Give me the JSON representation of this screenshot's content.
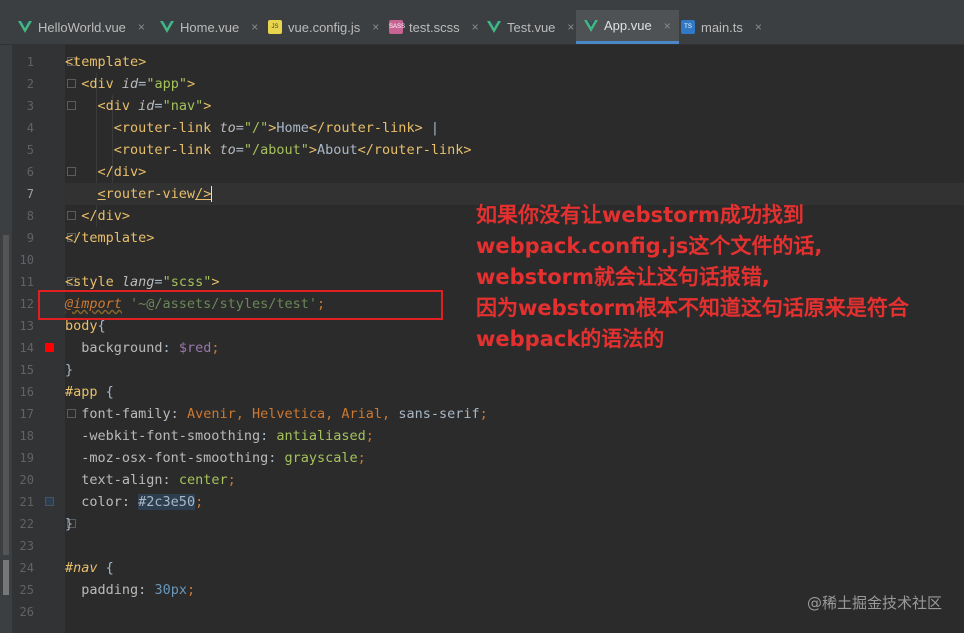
{
  "tabs": [
    {
      "label": "HelloWorld.vue",
      "type": "vue",
      "active": false
    },
    {
      "label": "Home.vue",
      "type": "vue",
      "active": false
    },
    {
      "label": "vue.config.js",
      "type": "js",
      "active": false
    },
    {
      "label": "test.scss",
      "type": "scss",
      "active": false
    },
    {
      "label": "Test.vue",
      "type": "vue",
      "active": false
    },
    {
      "label": "App.vue",
      "type": "vue",
      "active": true
    },
    {
      "label": "main.ts",
      "type": "ts",
      "active": false
    }
  ],
  "close_glyph": "×",
  "badges": {
    "js": "JS",
    "scss": "SASS",
    "ts": "TS"
  },
  "line_numbers": [
    "1",
    "2",
    "3",
    "4",
    "5",
    "6",
    "7",
    "8",
    "9",
    "10",
    "11",
    "12",
    "13",
    "14",
    "15",
    "16",
    "17",
    "18",
    "19",
    "20",
    "21",
    "22",
    "23",
    "24",
    "25",
    "26"
  ],
  "current_line": "7",
  "code": {
    "l1_tag": "<template>",
    "l2_open": "<div ",
    "l2_attr": "id",
    "l2_eq": "=",
    "l2_val": "\"app\"",
    "l2_close": ">",
    "l3_open": "<div ",
    "l3_attr": "id",
    "l3_eq": "=",
    "l3_val": "\"nav\"",
    "l3_close": ">",
    "l4_open": "<router-link ",
    "l4_attr": "to",
    "l4_eq": "=",
    "l4_val": "\"/\"",
    "l4_close": ">",
    "l4_text": "Home",
    "l4_end": "</router-link>",
    "l4_caret": " |",
    "l5_open": "<router-link ",
    "l5_attr": "to",
    "l5_eq": "=",
    "l5_val": "\"/about\"",
    "l5_close": ">",
    "l5_text": "About",
    "l5_end": "</router-link>",
    "l6_tag": "</div>",
    "l7_lt": "<",
    "l7_tag": "router-view",
    "l7_end": "/>",
    "l8_tag": "</div>",
    "l9_tag": "</template>",
    "l11_open": "<style ",
    "l11_attr": "lang",
    "l11_eq": "=",
    "l11_val": "\"scss\"",
    "l11_close": ">",
    "l12_kw": "@import",
    "l12_str": " '~@/assets/styles/test'",
    "l12_semi": ";",
    "l13_sel": "body",
    "l13_brace": "{",
    "l14_prop": "background",
    "l14_colon": ": ",
    "l14_val": "$red",
    "l14_semi": ";",
    "l15_brace": "}",
    "l16_sel": "#app",
    "l16_brace": " {",
    "l17_prop": "font-family",
    "l17_colon": ": ",
    "l17_v1": "Avenir",
    "l17_c1": ", ",
    "l17_v2": "Helvetica",
    "l17_c2": ", ",
    "l17_v3": "Arial",
    "l17_c3": ", ",
    "l17_v4": "sans-serif",
    "l17_semi": ";",
    "l18_prop": "-webkit-font-smoothing",
    "l18_colon": ": ",
    "l18_val": "antialiased",
    "l18_semi": ";",
    "l19_prop": "-moz-osx-font-smoothing",
    "l19_colon": ": ",
    "l19_val": "grayscale",
    "l19_semi": ";",
    "l20_prop": "text-align",
    "l20_colon": ": ",
    "l20_val": "center",
    "l20_semi": ";",
    "l21_prop": "color",
    "l21_colon": ": ",
    "l21_val": "#2c3e50",
    "l21_semi": ";",
    "l22_brace": "}",
    "l24_sel": "#nav",
    "l24_brace": " {",
    "l25_prop": "padding",
    "l25_colon": ": ",
    "l25_val": "30px",
    "l25_semi": ";"
  },
  "annotation_lines": [
    "如果你没有让webstorm成功找到",
    "webpack.config.js这个文件的话,",
    "webstorm就会让这句话报错,",
    "因为webstorm根本不知道这句话原来是符合",
    "webpack的语法的"
  ],
  "watermark": "@稀土掘金技术社区",
  "colors": {
    "annotation": "#e53030",
    "red_swatch": "#ff0000",
    "color_swatch": "#2c3e50",
    "active_tab_underline": "#4a88c7"
  }
}
